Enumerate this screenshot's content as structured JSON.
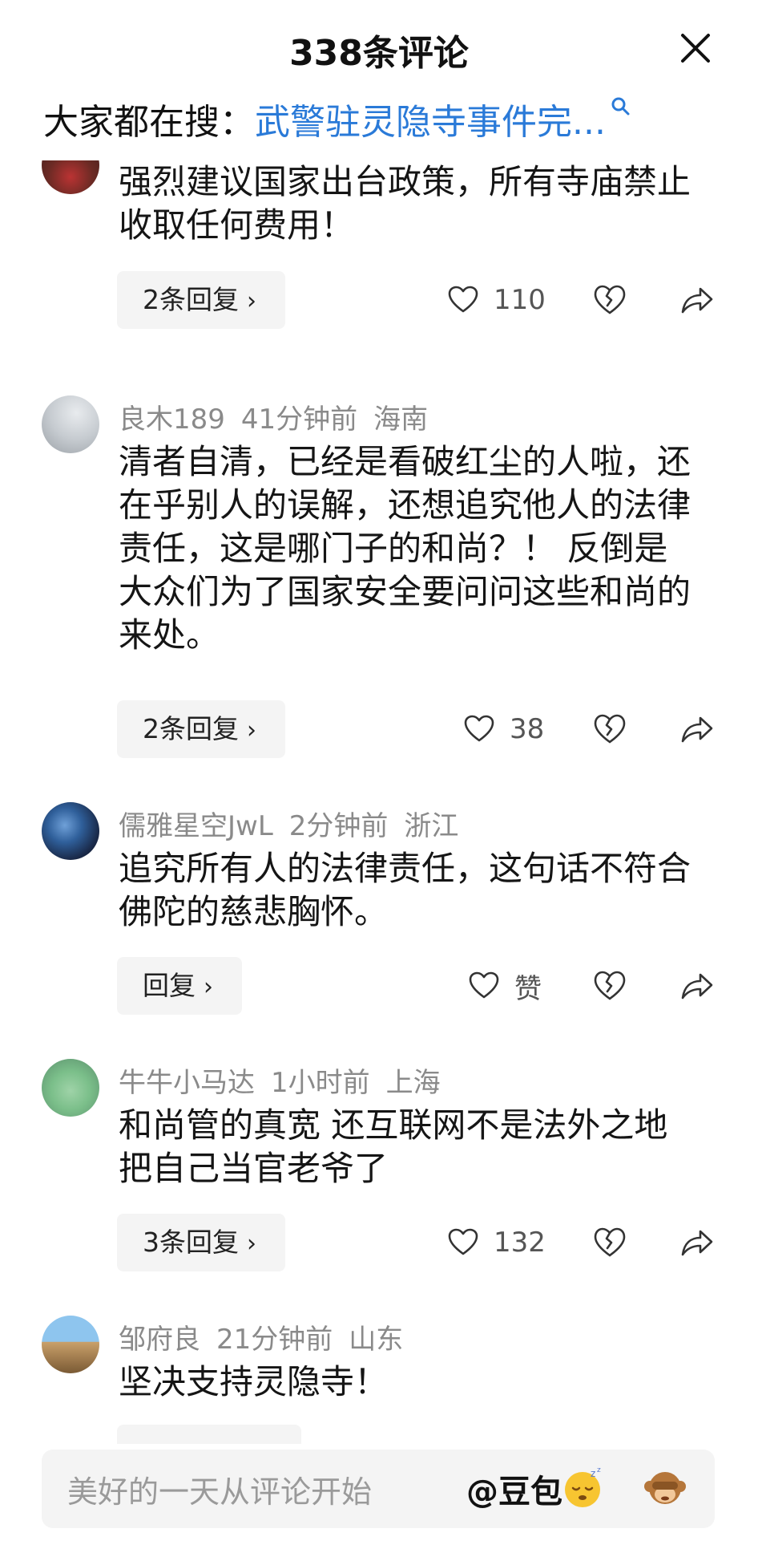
{
  "header": {
    "title": "338条评论",
    "search_prefix": "大家都在搜：",
    "search_query": "武警驻灵隐寺事件完..."
  },
  "comments": [
    {
      "text": "强烈建议国家出台政策，所有寺庙禁止收取任何费用！",
      "reply_label": "2条回复",
      "likes": "110"
    },
    {
      "user": "良木189",
      "time": "41分钟前",
      "location": "海南",
      "text": "清者自清，已经是看破红尘的人啦，还在乎别人的误解，还想追究他人的法律责任，这是哪门子的和尚？！ 反倒是大众们为了国家安全要问问这些和尚的来处。",
      "reply_label": "2条回复",
      "likes": "38"
    },
    {
      "user": "儒雅星空JwL",
      "time": "2分钟前",
      "location": "浙江",
      "text": "追究所有人的法律责任，这句话不符合佛陀的慈悲胸怀。",
      "reply_label": "回复",
      "likes": "赞"
    },
    {
      "user": "牛牛小马达",
      "time": "1小时前",
      "location": "上海",
      "text": "和尚管的真宽 还互联网不是法外之地 把自己当官老爷了",
      "reply_label": "3条回复",
      "likes": "132"
    },
    {
      "user": "邹府良",
      "time": "21分钟前",
      "location": "山东",
      "text": "坚决支持灵隐寺！"
    }
  ],
  "input": {
    "placeholder": "美好的一天从评论开始",
    "mention": "@豆包"
  },
  "icons": {
    "close": "close-icon",
    "search": "search-icon",
    "like": "heart-outline-icon",
    "dislike": "broken-heart-icon",
    "share": "share-arrow-icon",
    "emoji_1": "sleepy-face-emoji",
    "emoji_2": "see-no-evil-monkey-emoji"
  },
  "colors": {
    "link": "#2a7ad8",
    "meta_text": "#8a8a8a",
    "reply_bg": "#f4f4f4"
  }
}
